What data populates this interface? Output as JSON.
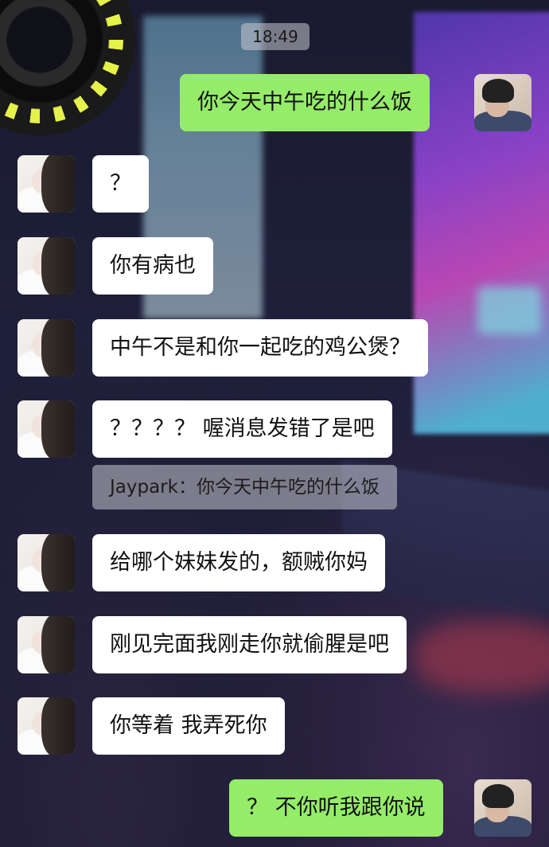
{
  "status": {
    "time": "18:49"
  },
  "contacts": {
    "me": {
      "avatar_icon": "male-avatar-icon"
    },
    "other": {
      "avatar_icon": "female-avatar-icon"
    }
  },
  "messages": [
    {
      "sender": "me",
      "text": "你今天中午吃的什么饭"
    },
    {
      "sender": "other",
      "text": "？"
    },
    {
      "sender": "other",
      "text": "你有病也"
    },
    {
      "sender": "other",
      "text": "中午不是和你一起吃的鸡公煲？"
    },
    {
      "sender": "other",
      "text": "？？？？ 喔消息发错了是吧",
      "quote": "Jaypark：你今天中午吃的什么饭"
    },
    {
      "sender": "other",
      "text": "给哪个妹妹发的，额贼你妈"
    },
    {
      "sender": "other",
      "text": "刚见完面我刚走你就偷腥是吧"
    },
    {
      "sender": "other",
      "text": "你等着 我弄死你"
    },
    {
      "sender": "me",
      "text": "？ 不你听我跟你说"
    }
  ],
  "colors": {
    "bubble_out": "#95ec69",
    "bubble_in": "#ffffff",
    "time_badge": "#c8c8d2"
  }
}
